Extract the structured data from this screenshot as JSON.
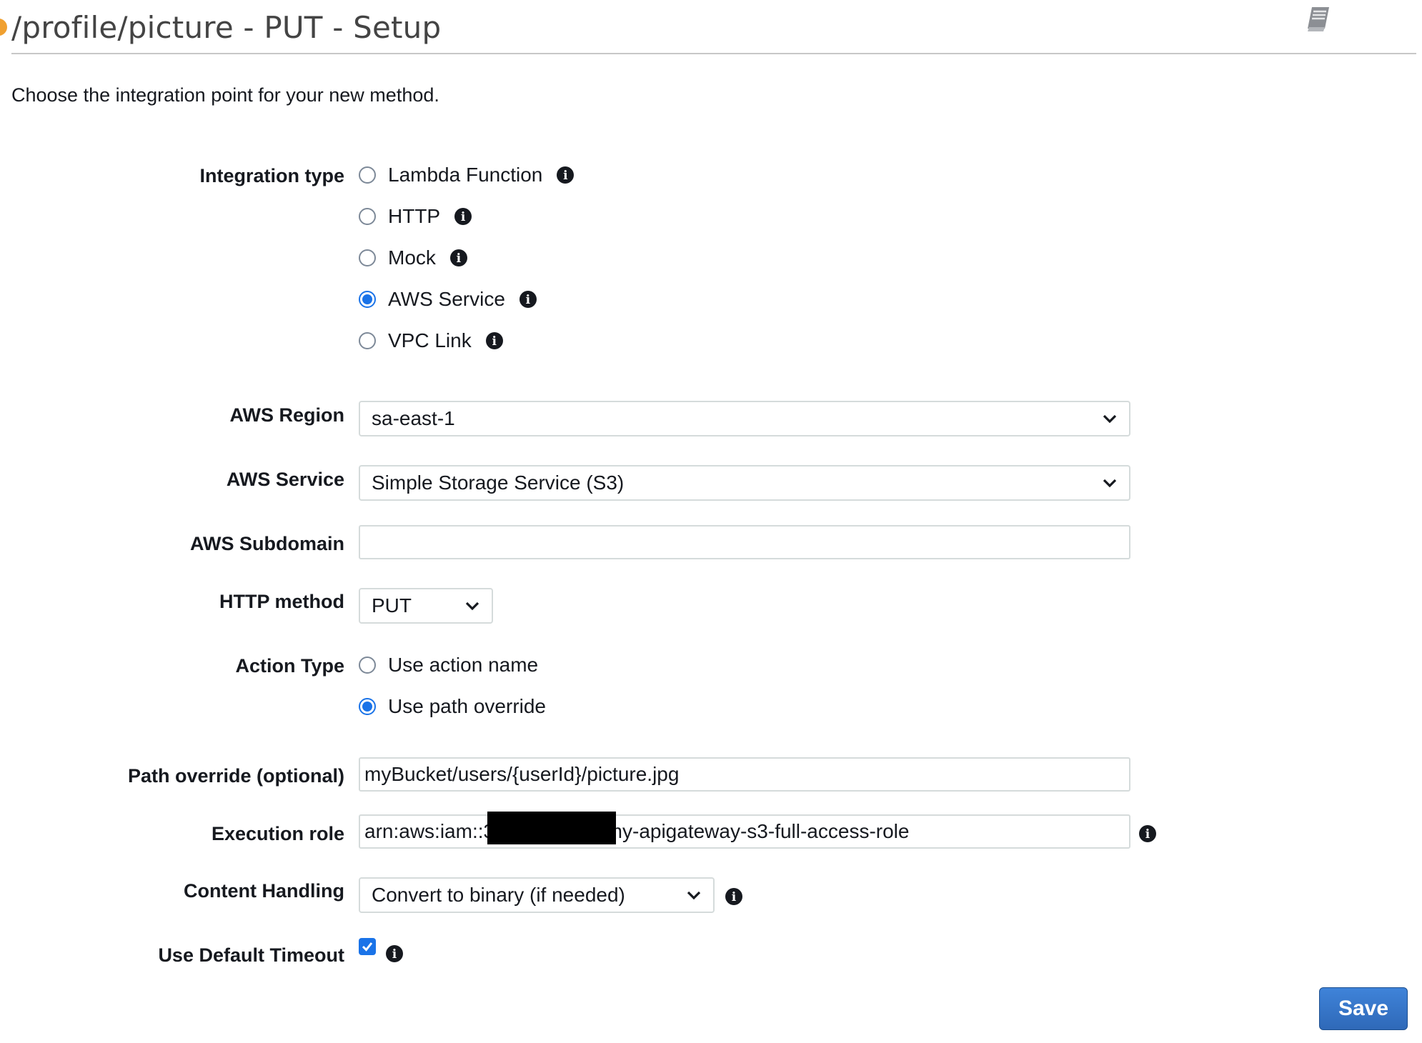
{
  "header": {
    "title": "/profile/picture - PUT - Setup",
    "intro": "Choose the integration point for your new method."
  },
  "integration_type": {
    "label": "Integration type",
    "options": [
      {
        "label": "Lambda Function",
        "selected": false
      },
      {
        "label": "HTTP",
        "selected": false
      },
      {
        "label": "Mock",
        "selected": false
      },
      {
        "label": "AWS Service",
        "selected": true
      },
      {
        "label": "VPC Link",
        "selected": false
      }
    ]
  },
  "aws_region": {
    "label": "AWS Region",
    "value": "sa-east-1"
  },
  "aws_service": {
    "label": "AWS Service",
    "value": "Simple Storage Service (S3)"
  },
  "aws_subdomain": {
    "label": "AWS Subdomain",
    "value": ""
  },
  "http_method": {
    "label": "HTTP method",
    "value": "PUT"
  },
  "action_type": {
    "label": "Action Type",
    "options": [
      {
        "label": "Use action name",
        "selected": false
      },
      {
        "label": "Use path override",
        "selected": true
      }
    ]
  },
  "path_override": {
    "label": "Path override (optional)",
    "value": "myBucket/users/{userId}/picture.jpg"
  },
  "execution_role": {
    "label": "Execution role",
    "value": "arn:aws:iam::3            :role/my-apigateway-s3-full-access-role"
  },
  "content_handling": {
    "label": "Content Handling",
    "value": "Convert to binary (if needed)"
  },
  "default_timeout": {
    "label": "Use Default Timeout",
    "checked": true
  },
  "save_label": "Save",
  "colors": {
    "accent": "#1a73e8",
    "save_button": "#2f69b8"
  }
}
